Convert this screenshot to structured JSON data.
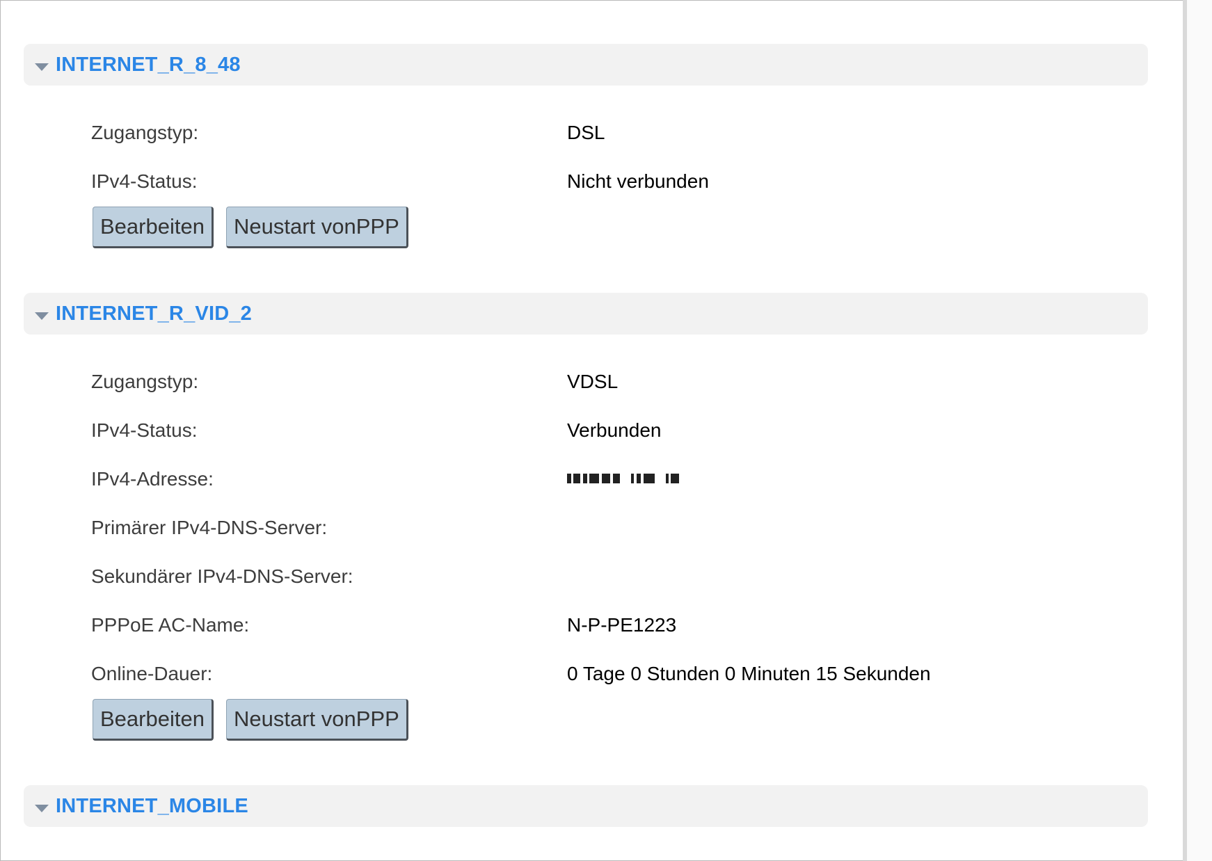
{
  "sections": [
    {
      "title": "INTERNET_R_8_48",
      "rows": [
        {
          "label": "Zugangstyp:",
          "value": "DSL"
        },
        {
          "label": "IPv4-Status:",
          "value": "Nicht verbunden"
        }
      ],
      "buttons": {
        "edit": "Bearbeiten",
        "restart": "Neustart vonPPP"
      }
    },
    {
      "title": "INTERNET_R_VID_2",
      "rows": [
        {
          "label": "Zugangstyp:",
          "value": "VDSL"
        },
        {
          "label": "IPv4-Status:",
          "value": "Verbunden"
        },
        {
          "label": "IPv4-Adresse:",
          "value": ""
        },
        {
          "label": "Primärer IPv4-DNS-Server:",
          "value": ""
        },
        {
          "label": "Sekundärer IPv4-DNS-Server:",
          "value": ""
        },
        {
          "label": "PPPoE AC-Name:",
          "value": "N-P-PE1223"
        },
        {
          "label": "Online-Dauer:",
          "value": "0 Tage 0 Stunden 0 Minuten 15 Sekunden"
        }
      ],
      "buttons": {
        "edit": "Bearbeiten",
        "restart": "Neustart vonPPP"
      }
    },
    {
      "title": "INTERNET_MOBILE"
    }
  ],
  "colors": {
    "section_title": "#2b86e6",
    "section_header_bg": "#f2f2f2",
    "button_bg": "#bed0df"
  }
}
